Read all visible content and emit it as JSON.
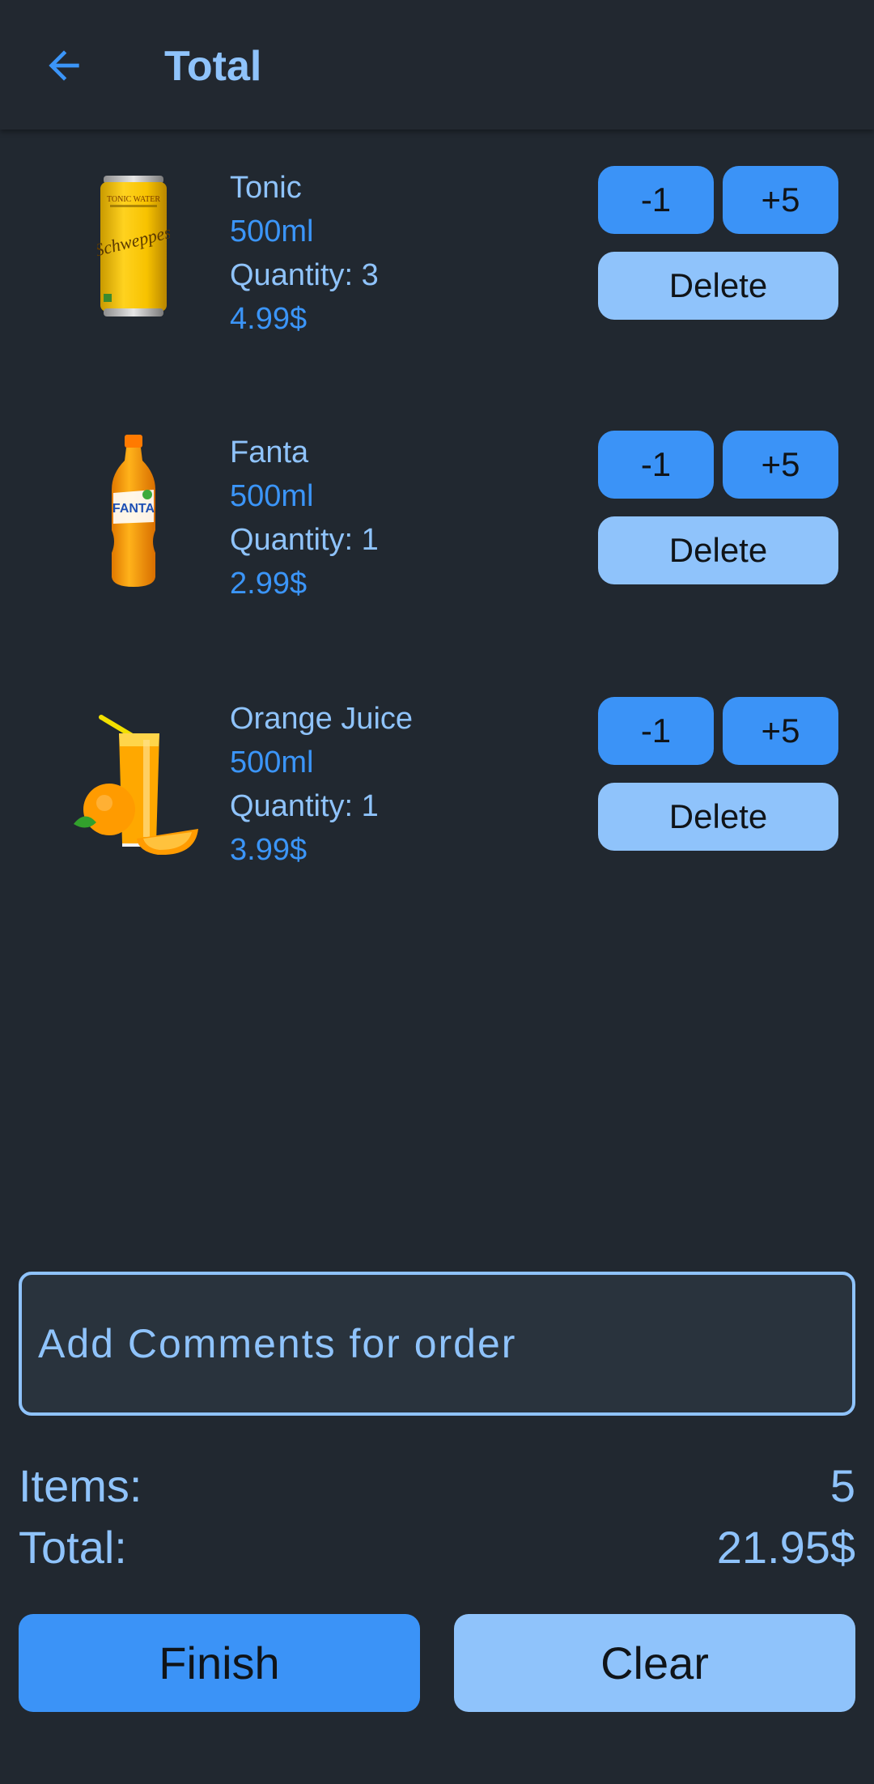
{
  "header": {
    "title": "Total",
    "back_icon": "arrow-left-icon"
  },
  "items": [
    {
      "name": "Tonic",
      "volume": "500ml",
      "quantity": "Quantity: 3",
      "price": "4.99$",
      "minus_label": "-1",
      "plus_label": "+5",
      "delete_label": "Delete",
      "image": "tonic-can"
    },
    {
      "name": "Fanta",
      "volume": "500ml",
      "quantity": "Quantity: 1",
      "price": "2.99$",
      "minus_label": "-1",
      "plus_label": "+5",
      "delete_label": "Delete",
      "image": "fanta-bottle"
    },
    {
      "name": "Orange Juice",
      "volume": "500ml",
      "quantity": "Quantity: 1",
      "price": "3.99$",
      "minus_label": "-1",
      "plus_label": "+5",
      "delete_label": "Delete",
      "image": "orange-juice-glass"
    }
  ],
  "comment": {
    "placeholder": "Add Comments for order",
    "value": ""
  },
  "summary": {
    "items_label": "Items:",
    "items_value": "5",
    "total_label": "Total:",
    "total_value": "21.95$"
  },
  "actions": {
    "finish_label": "Finish",
    "clear_label": "Clear"
  },
  "colors": {
    "background": "#212830",
    "accent": "#3b93f7",
    "accent_light": "#8fc3fb",
    "field_bg": "#29333d"
  }
}
